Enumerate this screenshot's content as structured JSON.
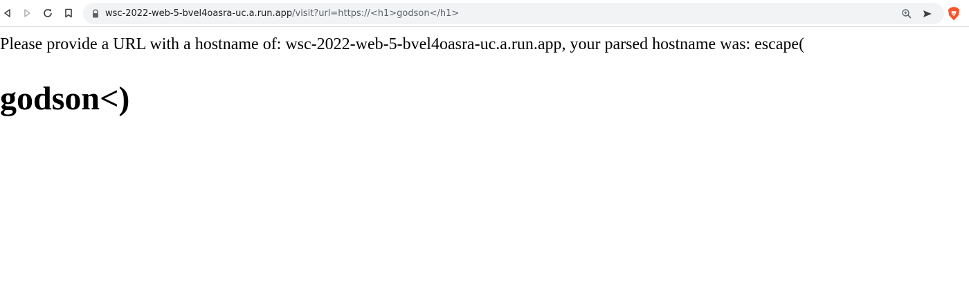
{
  "browser": {
    "url_host": "wsc-2022-web-5-bvel4oasra-uc.a.run.app",
    "url_path": "/visit?url=https://<h1>godson</h1>"
  },
  "page": {
    "message": "Please provide a URL with a hostname of: wsc-2022-web-5-bvel4oasra-uc.a.run.app, your parsed hostname was: escape(",
    "heading": "godson<)"
  },
  "icons": {
    "back": "back-arrow-icon",
    "forward": "forward-arrow-icon",
    "reload": "reload-icon",
    "bookmark": "bookmark-icon",
    "lock": "lock-icon",
    "zoom": "zoom-icon",
    "share": "send-icon",
    "brave": "brave-shield-icon"
  },
  "colors": {
    "brave_orange": "#fb542b",
    "omnibox_bg": "#f1f3f4"
  }
}
